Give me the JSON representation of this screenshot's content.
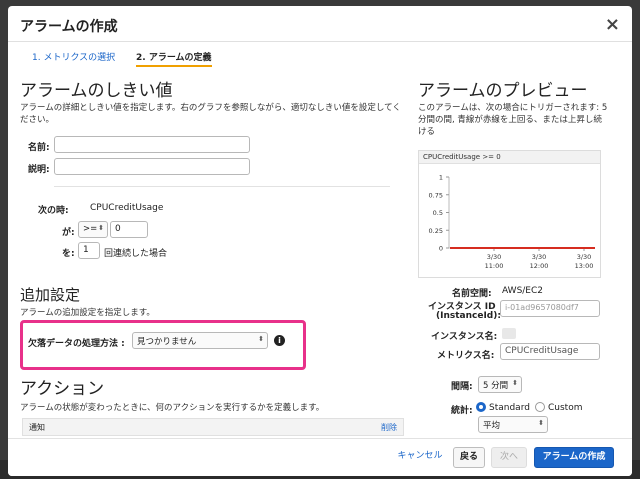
{
  "modal": {
    "title": "アラームの作成",
    "close": "×"
  },
  "steps": {
    "step1": "1. メトリクスの選択",
    "step2": "2. アラームの定義"
  },
  "threshold": {
    "heading": "アラームのしきい値",
    "desc": "アラームの詳細としきい値を指定します。右のグラフを参照しながら、適切なしきい値を設定してください。",
    "name_label": "名前:",
    "desc_label": "説明:",
    "when_label": "次の時:",
    "when_value": "CPUCreditUsage",
    "is_label": "が:",
    "operator": ">=",
    "threshold_value": "0",
    "for_label": "を:",
    "periods_value": "1",
    "periods_suffix": "回連続した場合"
  },
  "additional": {
    "heading": "追加設定",
    "desc": "アラームの追加設定を指定します。",
    "missing_label": "欠落データの処理方法 :",
    "missing_value": "見つかりません",
    "info": "i"
  },
  "actions": {
    "heading": "アクション",
    "desc": "アラームの状態が変わったときに、何のアクションを実行するかを定義します。",
    "col_notify": "通知",
    "delete": "削除"
  },
  "preview": {
    "heading": "アラームのプレビュー",
    "desc": "このアラームは、次の場合にトリガーされます: 5分間の間, 青線が赤線を上回る、または上昇し続ける",
    "namespace_label": "名前空間:",
    "namespace_value": "AWS/EC2",
    "instance_label_1": "インスタンス ID",
    "instance_label_2": "(InstanceId):",
    "instance_value": "i-01ad9657080df7",
    "instance_name_label": "インスタンス名:",
    "metric_label": "メトリクス名:",
    "metric_value": "CPUCreditUsage",
    "period_label": "間隔:",
    "period_value": "5 分間",
    "stat_label": "統計:",
    "stat_standard": "Standard",
    "stat_custom": "Custom",
    "stat_value": "平均"
  },
  "footer": {
    "cancel": "キャンセル",
    "back": "戻る",
    "next": "次へ",
    "create": "アラームの作成"
  },
  "chart_data": {
    "type": "line",
    "title": "CPUCreditUsage >= 0",
    "y_ticks": [
      "1",
      "0.75",
      "0.5",
      "0.25",
      "0"
    ],
    "ylim": [
      0,
      1
    ],
    "x_ticks": [
      [
        "3/30",
        "11:00"
      ],
      [
        "3/30",
        "12:00"
      ],
      [
        "3/30",
        "13:00"
      ]
    ],
    "series": [
      {
        "values": [
          0,
          0,
          0
        ],
        "color": "#d62d20"
      }
    ]
  },
  "colors": {
    "accent": "#1b66c9",
    "highlight": "#e8318a",
    "step_underline": "#f0a000",
    "threshold_line": "#d62d20"
  }
}
